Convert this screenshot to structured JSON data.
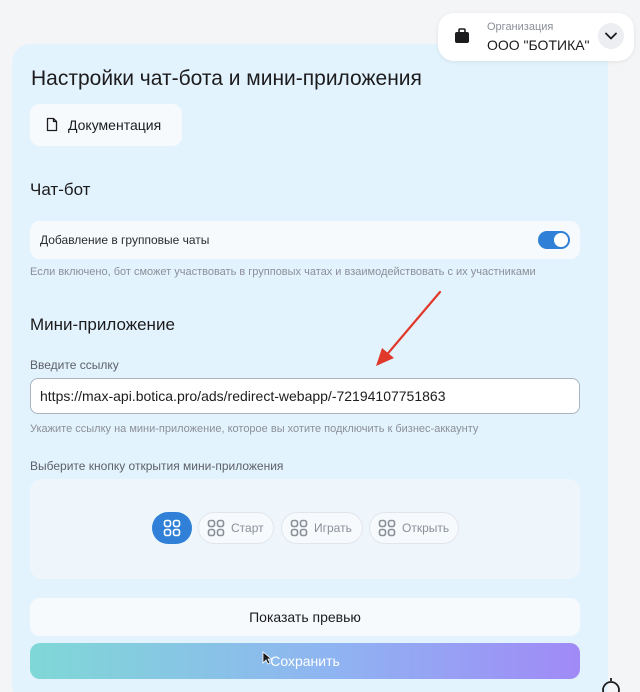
{
  "organization": {
    "label": "Организация",
    "name": "ООО \"БОТИКА\""
  },
  "page": {
    "title": "Настройки чат-бота и мини-приложения",
    "doc_button": "Документация"
  },
  "chatbot": {
    "section_title": "Чат-бот",
    "toggle_label": "Добавление в групповые чаты",
    "toggle_on": true,
    "hint": "Если включено, бот сможет участвовать в групповых чатах и взаимодействовать с их участниками"
  },
  "miniapp": {
    "section_title": "Мини-приложение",
    "link_label": "Введите ссылку",
    "link_value": "https://max-api.botica.pro/ads/redirect-webapp/-72194107751863",
    "link_hint": "Укажите ссылку на мини-приложение, которое вы хотите подключить к бизнес-аккаунту",
    "button_label": "Выберите кнопку открытия мини-приложения",
    "options": [
      "Старт",
      "Играть",
      "Открыть"
    ]
  },
  "actions": {
    "preview": "Показать превью",
    "save": "Сохранить"
  },
  "colors": {
    "accent": "#2f80d6",
    "panel_bg": "#e3f3fd",
    "annotation_arrow": "#e0392b"
  }
}
